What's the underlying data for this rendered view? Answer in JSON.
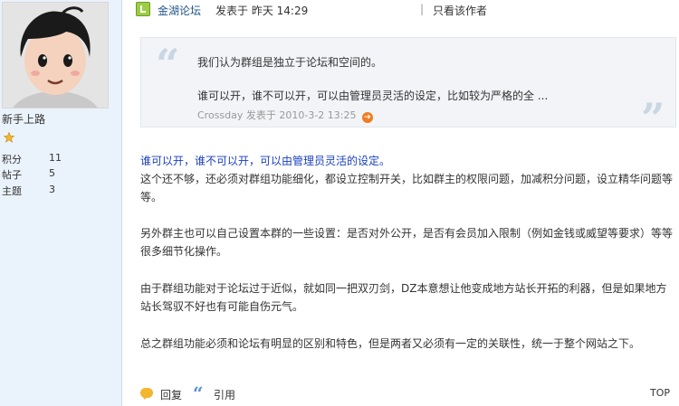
{
  "sidebar": {
    "user_title": "新手上路",
    "stats": [
      {
        "label": "积分",
        "value": "11"
      },
      {
        "label": "帖子",
        "value": "5"
      },
      {
        "label": "主题",
        "value": "3"
      }
    ]
  },
  "post_header": {
    "author": "金湖论坛",
    "meta": "发表于 昨天 14:29",
    "separator": "|",
    "only_author": "只看该作者"
  },
  "quote": {
    "line1": "我们认为群组是独立于论坛和空间的。",
    "line2": "谁可以开，谁不可以开，可以由管理员灵活的设定，比如较为严格的全 ...",
    "attribution": "Crossday 发表于 2010-3-2 13:25",
    "jump_icon": "jump-to-post-icon"
  },
  "body": {
    "highlight": "谁可以开，谁不可以开，可以由管理员灵活的设定。",
    "para1": "这个还不够，还必须对群组功能细化，都设立控制开关，比如群主的权限问题，加减积分问题，设立精华问题等等。",
    "para2": "另外群主也可以自己设置本群的一些设置：是否对外公开，是否有会员加入限制（例如金钱或威望等要求）等等很多细节化操作。",
    "para3": "由于群组功能对于论坛过于近似，就如同一把双刃剑，DZ本意想让他变成地方站长开拓的利器，但是如果地方站长驾驭不好也有可能自伤元气。",
    "para4": "总之群组功能必须和论坛有明显的区别和特色，但是两者又必须有一定的关联性，统一于整个网站之下。"
  },
  "footer": {
    "reply_label": "回复",
    "quote_label": "引用",
    "top_label": "TOP"
  },
  "colors": {
    "sidebar_bg": "#eaf2fb",
    "highlight_text": "#1a3fbf",
    "quote_bg": "#f2f4f7",
    "star": "#f2b630"
  }
}
